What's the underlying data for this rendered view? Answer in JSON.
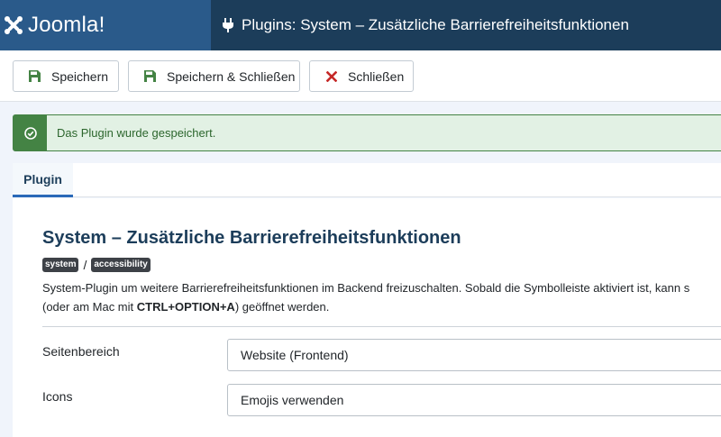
{
  "header": {
    "brand": "Joomla!",
    "title": "Plugins: System – Zusätzliche Barrierefreiheitsfunktionen",
    "brand_icon": "joomla-logo-icon",
    "title_icon": "plug-icon"
  },
  "toolbar": {
    "save_label": "Speichern",
    "save_close_label": "Speichern & Schließen",
    "close_label": "Schließen"
  },
  "alert": {
    "message": "Das Plugin wurde gespeichert.",
    "icon": "check-circle-icon"
  },
  "tabs": [
    {
      "label": "Plugin",
      "active": true
    }
  ],
  "plugin": {
    "title": "System – Zusätzliche Barrierefreiheitsfunktionen",
    "badges": [
      "system",
      "accessibility"
    ],
    "description_line1": "System-Plugin um weitere Barrierefreiheitsfunktionen im Backend freizuschalten. Sobald die Symbolleiste aktiviert ist, kann s",
    "description_line2_pre": "(oder am Mac mit ",
    "description_shortcut": "CTRL+OPTION+A",
    "description_line2_post": ") geöffnet werden."
  },
  "fields": [
    {
      "label": "Seitenbereich",
      "value": "Website (Frontend)"
    },
    {
      "label": "Icons",
      "value": "Emojis verwenden"
    }
  ],
  "colors": {
    "header_bg": "#1c3d5a",
    "brand_bg": "#2a5a8a",
    "success": "#448344",
    "success_bg": "#e2f1e4",
    "danger": "#c52827",
    "title": "#1c3d5a"
  }
}
